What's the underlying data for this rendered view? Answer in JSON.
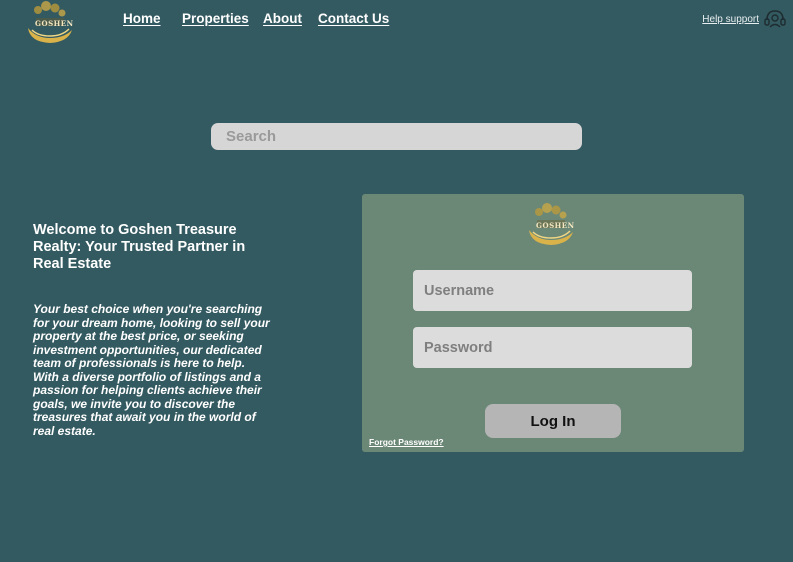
{
  "brand": {
    "logo_text": "GOSHEN",
    "accent": "#d9b24a",
    "background": "#345a61",
    "card_background": "#6b8877"
  },
  "nav": {
    "items": [
      {
        "label": "Home"
      },
      {
        "label": "Properties"
      },
      {
        "label": "About"
      },
      {
        "label": "Contact Us"
      }
    ]
  },
  "help": {
    "label": "Help support",
    "icon": "headset-icon"
  },
  "search": {
    "placeholder": "Search"
  },
  "welcome": {
    "heading": "Welcome to Goshen Treasure Realty: Your Trusted Partner in Real Estate",
    "body": "Your best choice when you're searching for your dream home, looking to sell your property at the best price, or seeking investment opportunities, our dedicated team of professionals is here to help. With a diverse portfolio of listings and a passion for helping clients achieve their goals, we invite you to discover the treasures that await you in the world of real estate."
  },
  "login": {
    "username_placeholder": "Username",
    "password_placeholder": "Password",
    "button_label": "Log In",
    "forgot_label": "Forgot Password?"
  }
}
